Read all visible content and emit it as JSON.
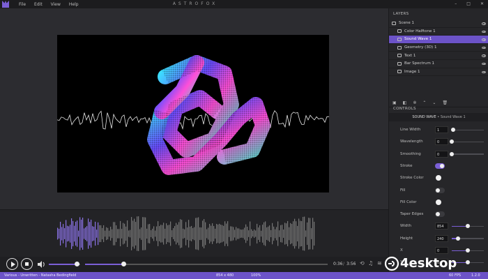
{
  "app": {
    "title": "ASTROFOX"
  },
  "menu": [
    "File",
    "Edit",
    "View",
    "Help"
  ],
  "window_controls": [
    "–",
    "□",
    "✕"
  ],
  "layers_panel": {
    "title": "LAYERS",
    "items": [
      {
        "label": "Scene 1",
        "selected": false
      },
      {
        "label": "Color Halftone 1",
        "selected": false
      },
      {
        "label": "Sound Wave 1",
        "selected": true
      },
      {
        "label": "Geometry (3D) 1",
        "selected": false
      },
      {
        "label": "Text 1",
        "selected": false
      },
      {
        "label": "Bar Spectrum 1",
        "selected": false
      },
      {
        "label": "Image 1",
        "selected": false
      }
    ]
  },
  "controls_panel": {
    "title": "CONTROLS",
    "header": "SOUND WAVE",
    "header_sub": "Sound Wave 1",
    "rows": [
      {
        "label": "Line Width",
        "type": "slider",
        "value": "1",
        "fraction": 0.05
      },
      {
        "label": "Wavelength",
        "type": "slider",
        "value": "0",
        "fraction": 0.0
      },
      {
        "label": "Smoothing",
        "type": "slider",
        "value": "0",
        "fraction": 0.0
      },
      {
        "label": "Stroke",
        "type": "toggle",
        "on": true
      },
      {
        "label": "Stroke Color",
        "type": "color",
        "color": "#f2f2f2"
      },
      {
        "label": "Fill",
        "type": "toggle",
        "on": false
      },
      {
        "label": "Fill Color",
        "type": "color",
        "color": "#f2f2f2"
      },
      {
        "label": "Taper Edges",
        "type": "toggle",
        "on": false
      },
      {
        "label": "Width",
        "type": "slider",
        "value": "854",
        "fraction": 0.5
      },
      {
        "label": "Height",
        "type": "slider",
        "value": "240",
        "fraction": 0.2
      },
      {
        "label": "X",
        "type": "slider",
        "value": "0",
        "fraction": 0.5
      },
      {
        "label": "Y",
        "type": "slider",
        "value": "0",
        "fraction": 0.5
      }
    ]
  },
  "player": {
    "current_time": "0:36",
    "total_time": "3:56",
    "volume": 0.9,
    "progress": 0.16
  },
  "statusbar": {
    "track": "Various - Unwritten - Natasha Bedingfield",
    "resolution": "854 x 480",
    "zoom": "100%",
    "fps": "60 FPS",
    "version": "1.2.0"
  },
  "colors": {
    "accent": "#6c53c8",
    "bg": "#2a2a2d"
  },
  "watermark": {
    "text": "4esktop"
  }
}
